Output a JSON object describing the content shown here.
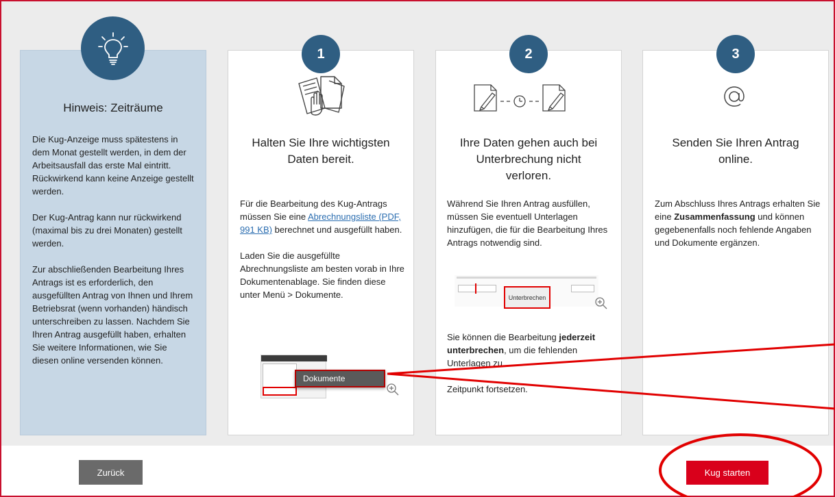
{
  "hint": {
    "title": "Hinweis: Zeiträume",
    "p1": "Die Kug-Anzeige muss spätestens in dem Monat gestellt werden, in dem der Arbeitsausfall das erste Mal eintritt. Rückwirkend kann keine Anzeige gestellt werden.",
    "p2": "Der Kug-Antrag kann nur rückwirkend (maximal bis zu drei Monaten) gestellt werden.",
    "p3": "Zur abschließenden Bearbeitung Ihres Antrags ist es erforderlich, den ausgefüllten Antrag von Ihnen und Ihrem Betriebsrat (wenn vorhanden) händisch unterschreiben zu lassen. Nachdem Sie Ihren Antrag ausgefüllt haben, erhalten Sie weitere Informationen, wie Sie diesen online versenden können."
  },
  "step1": {
    "number": "1",
    "title": "Halten Sie Ihre wichtigsten Daten bereit.",
    "p1_before": "Für die Bearbeitung des Kug-Antrags müssen Sie eine ",
    "p1_link": "Abrechnungsliste (PDF, 991 KB)",
    "p1_after": " berechnet und ausgefüllt haben.",
    "p2": "Laden Sie die ausgefüllte Abrechnungsliste am besten vorab in Ihre Dokumentenablage. Sie finden diese unter Menü > Dokumente.",
    "screenshot_label": "Dokumente"
  },
  "step2": {
    "number": "2",
    "title": "Ihre Daten gehen auch bei Unterbrechung nicht verloren.",
    "p1": "Während Sie Ihren Antrag ausfüllen, müssen Sie eventuell Unterlagen hinzufügen, die für die Bearbeitung Ihres Antrags notwendig sind.",
    "screenshot_button": "Unterbrechen",
    "p2_before": "Sie können die Bearbeitung ",
    "p2_bold": "jederzeit unterbrechen",
    "p2_after": ", um die fehlenden Unterlagen zu ...",
    "p2_line4": "Zeitpunkt fortsetzen."
  },
  "step3": {
    "number": "3",
    "title": "Senden Sie Ihren Antrag online.",
    "p1_before": "Zum Abschluss Ihres Antrags erhalten Sie eine ",
    "p1_bold": "Zusammenfassung",
    "p1_after": " und können gegebenenfalls noch fehlende Angaben und Dokumente ergänzen."
  },
  "footer": {
    "back_label": "Zurück",
    "start_label": "Kug starten"
  },
  "colors": {
    "accent_red": "#d9001b",
    "badge_blue": "#2f5e82",
    "hint_bg": "#c7d7e5",
    "annotation_red": "#e10000"
  },
  "icons": [
    "lightbulb-icon",
    "documents-hand-icon",
    "edit-clock-edit-icon",
    "at-sign-icon",
    "zoom-in-icon"
  ]
}
